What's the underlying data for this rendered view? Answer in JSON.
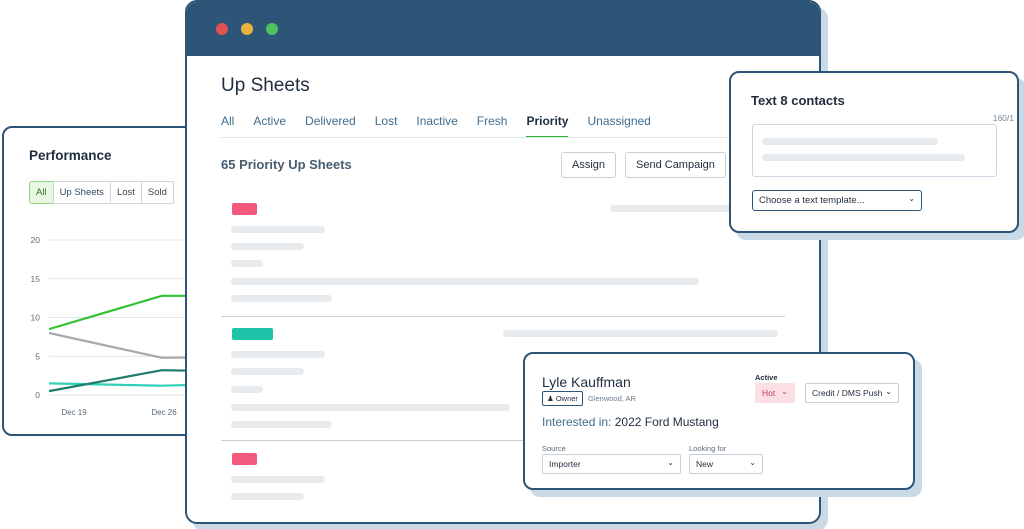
{
  "performance": {
    "title": "Performance",
    "filters": [
      "All",
      "Up Sheets",
      "Lost",
      "Sold"
    ],
    "active_filter": "All"
  },
  "chart_data": {
    "type": "line",
    "x": [
      "Dec 19",
      "Dec 26"
    ],
    "yticks": [
      "20",
      "15",
      "10",
      "5",
      "0"
    ],
    "ylim": [
      0,
      20
    ],
    "series": [
      {
        "color": "#33c233",
        "values": [
          8.5,
          12.8,
          12.8
        ]
      },
      {
        "color": "#a8a8a8",
        "values": [
          8,
          4.8,
          4.9
        ]
      },
      {
        "color": "#2ed1b5",
        "values": [
          1.5,
          1.2,
          1.5
        ]
      },
      {
        "color": "#1f7b6a",
        "values": [
          0.5,
          3.2,
          3
        ]
      }
    ]
  },
  "main": {
    "title": "Up Sheets",
    "tabs": [
      "All",
      "Active",
      "Delivered",
      "Lost",
      "Inactive",
      "Fresh",
      "Priority",
      "Unassigned"
    ],
    "active_tab": "Priority",
    "count_label": "65 Priority Up Sheets",
    "assign_label": "Assign",
    "send_campaign_label": "Send Campaign",
    "row_tag_colors": [
      "#f25a7d",
      "#1fc4a8",
      "#f25a7d"
    ],
    "window_dots": [
      "#e05252",
      "#e8b33c",
      "#4fc25a"
    ]
  },
  "text_panel": {
    "title": "Text 8 contacts",
    "counter": "160/1",
    "template_placeholder": "Choose a text template..."
  },
  "contact": {
    "name": "Lyle Kauffman",
    "owner_label": "Owner",
    "location": "Glenwood, AR",
    "interested_prefix": "Interested in:",
    "interested_vehicle": "2022 Ford Mustang",
    "active_label": "Active",
    "status": "Hot",
    "credit_label": "Credit / DMS Push",
    "source_label": "Source",
    "source_value": "Importer",
    "looking_for_label": "Looking for",
    "looking_for_value": "New"
  }
}
